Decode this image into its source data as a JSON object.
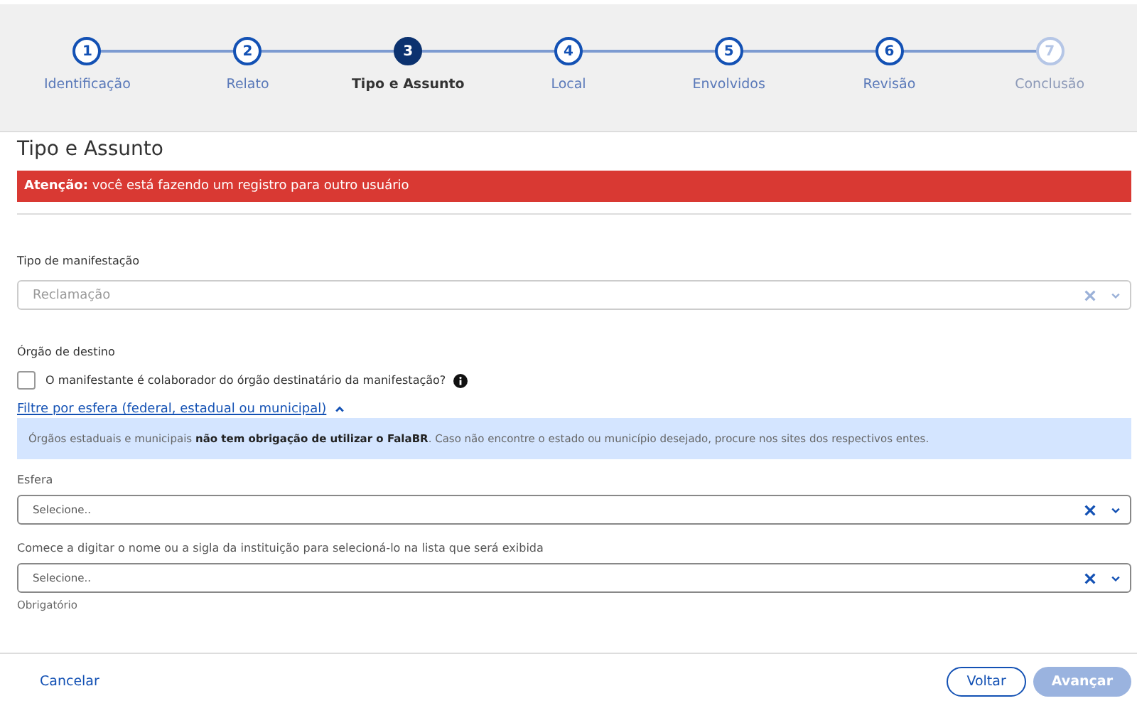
{
  "steps": [
    {
      "number": "1",
      "label": "Identificação",
      "selected": false,
      "disabled": false
    },
    {
      "number": "2",
      "label": "Relato",
      "selected": false,
      "disabled": false
    },
    {
      "number": "3",
      "label": "Tipo e Assunto",
      "selected": true,
      "disabled": false
    },
    {
      "number": "4",
      "label": "Local",
      "selected": false,
      "disabled": false
    },
    {
      "number": "5",
      "label": "Envolvidos",
      "selected": false,
      "disabled": false
    },
    {
      "number": "6",
      "label": "Revisão",
      "selected": false,
      "disabled": false
    },
    {
      "number": "7",
      "label": "Conclusão",
      "selected": false,
      "disabled": true
    }
  ],
  "page_title": "Tipo e Assunto",
  "alert": "**Atenção:** você está fazendo um registro para outro usuário",
  "tipo": {
    "label": "Tipo de manifestação",
    "value": "Reclamação",
    "disabled": true
  },
  "orgao": {
    "label": "Órgão de destino",
    "checkbox": {
      "label": "O manifestante é colaborador do órgão destinatário da manifestação?",
      "checked": false
    },
    "filter_link": {
      "label": "Filtre por esfera (federal, estadual ou municipal)",
      "expanded": true
    },
    "info": "Órgãos estaduais e municipais **não tem obrigação de utilizar o FalaBR**. Caso não encontre o estado ou município desejado, procure nos sites dos respectivos entes."
  },
  "esfera": {
    "label": "Esfera",
    "placeholder": "Selecione..",
    "disabled": false
  },
  "instituicao": {
    "label": "Comece a digitar o nome ou a sigla da instituição para selecioná-lo na lista que será exibida",
    "placeholder": "Selecione..",
    "disabled": false,
    "hint": "Obrigatório"
  },
  "footer": {
    "cancel": "Cancelar",
    "back": "Voltar",
    "next": {
      "label": "Avançar",
      "disabled": true
    }
  }
}
